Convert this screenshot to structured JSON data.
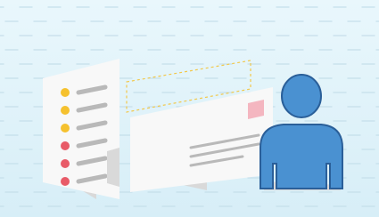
{
  "colors": {
    "background_top": "#e9f7fc",
    "background_bottom": "#d7eef7",
    "grid_dash": "#c5dfea",
    "paper": "#f8f8f8",
    "paper_shadow": "#d9d9d9",
    "bullet_yellow": "#f5c12e",
    "bullet_red": "#e85b68",
    "line_gray": "#b9b9b9",
    "stamp_pink": "#f4b6c0",
    "dotted_yellow": "#f2c84b",
    "person_blue": "#4a91d1",
    "person_outline": "#2a5f99"
  },
  "icons": {
    "document": "document-icon",
    "envelope": "envelope-icon",
    "person": "person-icon",
    "selection": "dotted-selection-frame"
  },
  "document_bullets": [
    "yellow",
    "yellow",
    "yellow",
    "red",
    "red",
    "red"
  ]
}
